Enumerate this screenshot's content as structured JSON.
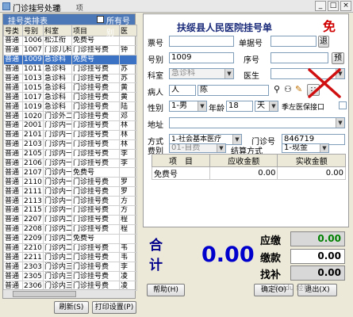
{
  "window": {
    "title": "门诊挂号处理",
    "controls": [
      "_",
      "□",
      "×"
    ],
    "menu": "二 选 项"
  },
  "left": {
    "header": "挂号类排表",
    "all_label": "所有号别",
    "columns": [
      "号类",
      "号别",
      "科室",
      "项目",
      "医"
    ],
    "rows": [
      [
        "普通",
        "1006",
        "松江衔",
        "免费号",
        ""
      ],
      [
        "普通",
        "1007",
        "门诊儿科",
        "门诊挂号费",
        "钟"
      ],
      [
        "普通",
        "1009",
        "急诊科",
        "免费号",
        ""
      ],
      [
        "普通",
        "1011",
        "急诊科",
        "门诊挂号费",
        "苏"
      ],
      [
        "普通",
        "1013",
        "急诊科",
        "门诊挂号费",
        "苏"
      ],
      [
        "普通",
        "1015",
        "急诊科",
        "门诊挂号费",
        "黄"
      ],
      [
        "普通",
        "1017",
        "急诊科",
        "门诊挂号费",
        "黄"
      ],
      [
        "普通",
        "1019",
        "急诊科",
        "门诊挂号费",
        "陆"
      ],
      [
        "普通",
        "1020",
        "门诊外二",
        "门诊挂号费",
        "邓"
      ],
      [
        "普通",
        "2001",
        "门诊内一",
        "门诊挂号费",
        "林"
      ],
      [
        "普通",
        "2101",
        "门诊内一",
        "门诊挂号费",
        "林"
      ],
      [
        "普通",
        "2103",
        "门诊内一",
        "门诊挂号费",
        "林"
      ],
      [
        "普通",
        "2105",
        "门诊内一",
        "门诊挂号费",
        "李"
      ],
      [
        "普通",
        "2106",
        "门诊内一",
        "门诊挂号费",
        "李"
      ],
      [
        "普通",
        "2107",
        "门诊内一",
        "免费号",
        ""
      ],
      [
        "普通",
        "2110",
        "门诊内一",
        "门诊挂号费",
        "罗"
      ],
      [
        "普通",
        "2111",
        "门诊内一",
        "门诊挂号费",
        "罗"
      ],
      [
        "普通",
        "2113",
        "门诊内一",
        "门诊挂号费",
        "方"
      ],
      [
        "普通",
        "2115",
        "门诊内一",
        "门诊挂号费",
        "方"
      ],
      [
        "普通",
        "2207",
        "门诊内二",
        "门诊挂号费",
        "程"
      ],
      [
        "普通",
        "2208",
        "门诊内二",
        "门诊挂号费",
        "程"
      ],
      [
        "普通",
        "2209",
        "门诊内二",
        "免费号",
        ""
      ],
      [
        "普通",
        "2210",
        "门诊内二",
        "门诊挂号费",
        "韦"
      ],
      [
        "普通",
        "2211",
        "门诊内二",
        "门诊挂号费",
        "韦"
      ],
      [
        "普通",
        "2303",
        "门诊内三",
        "门诊挂号费",
        "李"
      ],
      [
        "普通",
        "2305",
        "门诊内三",
        "门诊挂号费",
        "凌"
      ],
      [
        "普通",
        "2306",
        "门诊内三",
        "门诊挂号费",
        "凌"
      ]
    ],
    "selected_row": 2,
    "refresh": "刷新",
    "refresh_key": "(S)",
    "print": "打印设置",
    "print_key": "(P)"
  },
  "form": {
    "title": "扶绥县人民医院挂号单",
    "badge": "免",
    "seq_label": "票号",
    "seq_value": "",
    "bill_label": "单据号",
    "bill_value": "",
    "back_btn": "退",
    "dept_no_label": "号别",
    "dept_no_value": "1009",
    "order_label": "序号",
    "order_value": "",
    "reserve_btn": "预",
    "dept_label": "科室",
    "dept_value": "急诊科",
    "doctor_label": "医生",
    "doctor_value": "",
    "patient_label": "病人",
    "patient_value": "陈",
    "id_prefix": "人",
    "gender_label": "性别",
    "gender_value": "1-男",
    "age_label": "年龄",
    "age_value": "18",
    "age_unit": "天",
    "insurance_label": "季左医保接口",
    "address_label": "地址",
    "address_value": "",
    "mode_label": "方式",
    "mode_value": "1-社会基本医疗",
    "clinic_label": "门诊号",
    "clinic_value": "846719",
    "fee_type_label": "费别",
    "fee_type_value": "01-自费",
    "settle_label": "结算方式",
    "settle_value": "1-现金",
    "fee_columns": [
      "项　目",
      "应收金额",
      "实收金额"
    ],
    "fee_rows": [
      [
        "免费号",
        "0.00",
        "0.00"
      ]
    ]
  },
  "totals": {
    "label_top": "合",
    "label_bottom": "计",
    "amount": "0.00",
    "due_label": "应缴",
    "due_value": "0.00",
    "paid_label": "缴款",
    "paid_value": "0.00",
    "change_label": "找补",
    "change_value": "0.00"
  },
  "buttons": {
    "help": "帮助",
    "help_key": "(H)",
    "ok": "确定",
    "ok_key": "(O)",
    "exit": "退出",
    "exit_key": "(X)"
  },
  "watermark": "Baidu 经验",
  "colors": {
    "selection": "#3b72c4",
    "header": "#4c78b8",
    "total": "#0000cc",
    "badge": "#d00000",
    "due": "#008000"
  }
}
